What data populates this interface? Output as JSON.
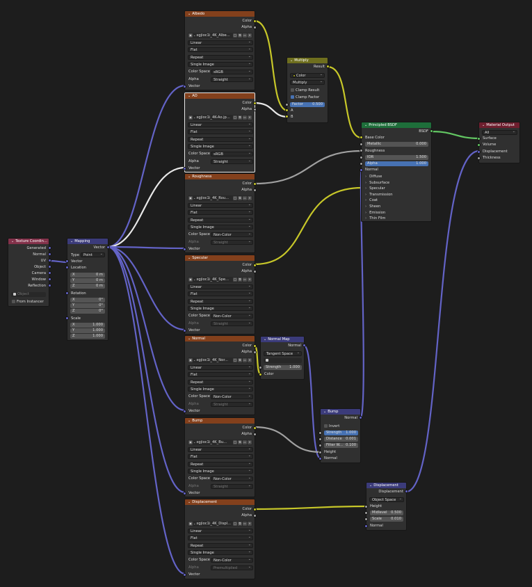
{
  "colors": {
    "texture_header": "#83401c",
    "mapping_header": "#3b3b7a",
    "texcoord_header": "#83314a",
    "multiply_header": "#6e6e1e",
    "bsdf_header": "#1e6e3a",
    "output_header": "#6e1e2e",
    "vector_header": "#3b3b7a",
    "color_wire": "#c7c729",
    "vector_wire": "#6363c7",
    "shader_wire": "#63c763",
    "gray_wire": "#a1a1a1",
    "selected_wire": "#e8e8e8",
    "highlight_field": "#4772b3",
    "background": "#1d1d1d"
  },
  "texture_coordinate": {
    "title": "Texture Coordin...",
    "outputs": [
      "Generated",
      "Normal",
      "UV",
      "Object",
      "Camera",
      "Window",
      "Reflection"
    ],
    "object_placeholder": "Object",
    "from_instancer": "From Instancer"
  },
  "mapping": {
    "title": "Mapping",
    "output": "Vector",
    "type_label": "Type",
    "type_value": "Point",
    "input_vector": "Vector",
    "location_label": "Location",
    "location": [
      {
        "axis": "X",
        "value": "0 m"
      },
      {
        "axis": "Y",
        "value": "0 m"
      },
      {
        "axis": "Z",
        "value": "0 m"
      }
    ],
    "rotation_label": "Rotation",
    "rotation": [
      {
        "axis": "X",
        "value": "0°"
      },
      {
        "axis": "Y",
        "value": "0°"
      },
      {
        "axis": "Z",
        "value": "0°"
      }
    ],
    "scale_label": "Scale",
    "scale": [
      {
        "axis": "X",
        "value": "1.000"
      },
      {
        "axis": "Y",
        "value": "1.000"
      },
      {
        "axis": "Z",
        "value": "1.000"
      }
    ]
  },
  "textures": [
    {
      "title": "Albedo",
      "file": "xgjioc1i_4K_Albe...",
      "interp": "Linear",
      "proj": "Flat",
      "ext": "Repeat",
      "source": "Single Image",
      "color_space": "sRGB",
      "alpha_mode": "Straight",
      "alpha_dim": false
    },
    {
      "title": "AO",
      "file": "xgjioc1i_4K-Ao.jp...",
      "interp": "Linear",
      "proj": "Flat",
      "ext": "Repeat",
      "source": "Single Image",
      "color_space": "sRGB",
      "alpha_mode": "Straight",
      "alpha_dim": false
    },
    {
      "title": "Roughness",
      "file": "xgjioc1i_4K_Rou...",
      "interp": "Linear",
      "proj": "Flat",
      "ext": "Repeat",
      "source": "Single Image",
      "color_space": "Non-Color",
      "alpha_mode": "Straight",
      "alpha_dim": true
    },
    {
      "title": "Specular",
      "file": "xgjioc1i_4K_Spe...",
      "interp": "Linear",
      "proj": "Flat",
      "ext": "Repeat",
      "source": "Single Image",
      "color_space": "Non-Color",
      "alpha_mode": "Straight",
      "alpha_dim": true
    },
    {
      "title": "Normal",
      "file": "xgjioc1i_4K_Nor...",
      "interp": "Linear",
      "proj": "Flat",
      "ext": "Repeat",
      "source": "Single Image",
      "color_space": "Non-Color",
      "alpha_mode": "Straight",
      "alpha_dim": true
    },
    {
      "title": "Bump",
      "file": "xgjioc1i_4K_Bu...",
      "interp": "Linear",
      "proj": "Flat",
      "ext": "Repeat",
      "source": "Single Image",
      "color_space": "Non-Color",
      "alpha_mode": "Straight",
      "alpha_dim": true
    },
    {
      "title": "Displacement",
      "file": "xgjioc1i_4K_Displ...",
      "interp": "Linear",
      "proj": "Flat",
      "ext": "Repeat",
      "source": "Single Image",
      "color_space": "Non-Color",
      "alpha_mode": "Premultiplied",
      "alpha_dim": true
    }
  ],
  "texture_labels": {
    "color": "Color",
    "alpha": "Alpha",
    "color_space": "Color Space",
    "alpha_label": "Alpha",
    "vector": "Vector"
  },
  "multiply": {
    "title": "Multiply",
    "output": "Result",
    "data_type": "Color",
    "blend": "Multiply",
    "clamp_result": "Clamp Result",
    "clamp_factor": "Clamp Factor",
    "factor_label": "Factor",
    "factor_value": "0.500",
    "input_a": "A",
    "input_b": "B"
  },
  "bsdf": {
    "title": "Principled BSDF",
    "output": "BSDF",
    "base_color": "Base Color",
    "metallic_label": "Metallic",
    "metallic_value": "0.000",
    "roughness": "Roughness",
    "ior_label": "IOR",
    "ior_value": "1.500",
    "alpha_label": "Alpha",
    "alpha_value": "1.000",
    "normal": "Normal",
    "panels": [
      "Diffuse",
      "Subsurface",
      "Specular",
      "Transmission",
      "Coat",
      "Sheen",
      "Emission",
      "Thin Film"
    ]
  },
  "material_output": {
    "title": "Material Output",
    "target": "All",
    "inputs": [
      "Surface",
      "Volume",
      "Displacement",
      "Thickness"
    ]
  },
  "normal_map": {
    "title": "Normal Map",
    "output": "Normal",
    "space": "Tangent Space",
    "strength_label": "Strength",
    "strength_value": "1.000",
    "color": "Color"
  },
  "bump": {
    "title": "Bump",
    "output": "Normal",
    "invert": "Invert",
    "strength_label": "Strength",
    "strength_value": "1.000",
    "distance_label": "Distance",
    "distance_value": "0.001",
    "filter_label": "Filter W...",
    "filter_value": "0.100",
    "height": "Height",
    "normal": "Normal"
  },
  "displacement": {
    "title": "Displacement",
    "output": "Displacement",
    "space": "Object Space",
    "height": "Height",
    "midlevel_label": "Midlevel",
    "midlevel_value": "0.500",
    "scale_label": "Scale",
    "scale_value": "0.010",
    "normal": "Normal"
  }
}
